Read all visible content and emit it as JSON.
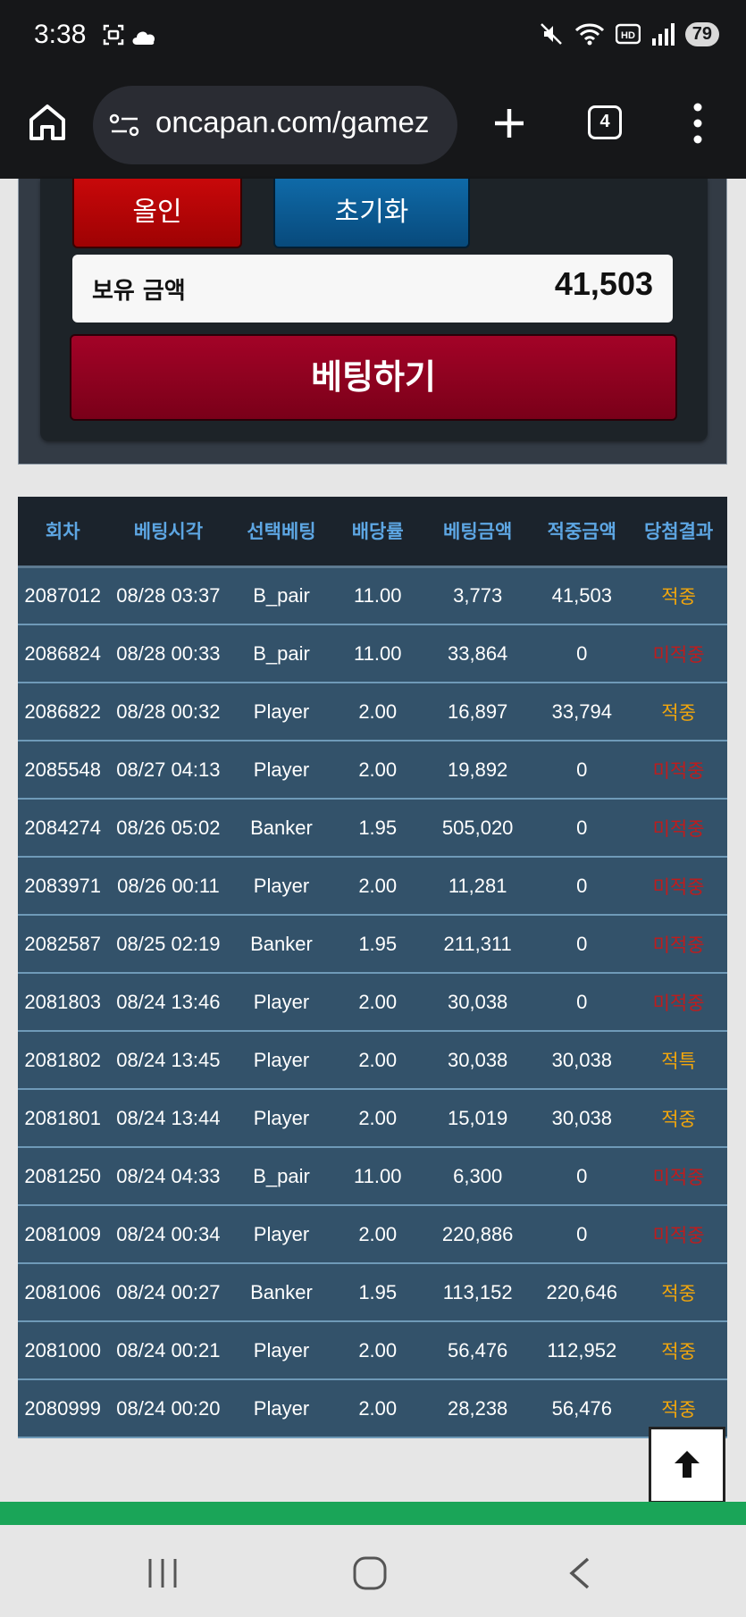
{
  "status_bar": {
    "time": "3:38",
    "battery": "79",
    "icons": [
      "screenshot-icon",
      "cloud-icon",
      "mute-icon",
      "wifi-icon",
      "hd-icon",
      "signal-icon"
    ]
  },
  "browser": {
    "url": "oncapan.com/gamez",
    "tab_count": "4"
  },
  "bet_panel": {
    "allin_label": "올인",
    "reset_label": "초기화",
    "balance_label": "보유 금액",
    "balance_value": "41,503",
    "bet_label": "베팅하기"
  },
  "table": {
    "headers": [
      "회차",
      "베팅시각",
      "선택베팅",
      "배당률",
      "베팅금액",
      "적중금액",
      "당첨결과"
    ],
    "rows": [
      {
        "round": "2087012",
        "time": "08/28 03:37",
        "pick": "B_pair",
        "odds": "11.00",
        "bet": "3,773",
        "payout": "41,503",
        "result": "적중",
        "status": "win"
      },
      {
        "round": "2086824",
        "time": "08/28 00:33",
        "pick": "B_pair",
        "odds": "11.00",
        "bet": "33,864",
        "payout": "0",
        "result": "미적중",
        "status": "lose"
      },
      {
        "round": "2086822",
        "time": "08/28 00:32",
        "pick": "Player",
        "odds": "2.00",
        "bet": "16,897",
        "payout": "33,794",
        "result": "적중",
        "status": "win"
      },
      {
        "round": "2085548",
        "time": "08/27 04:13",
        "pick": "Player",
        "odds": "2.00",
        "bet": "19,892",
        "payout": "0",
        "result": "미적중",
        "status": "lose"
      },
      {
        "round": "2084274",
        "time": "08/26 05:02",
        "pick": "Banker",
        "odds": "1.95",
        "bet": "505,020",
        "payout": "0",
        "result": "미적중",
        "status": "lose"
      },
      {
        "round": "2083971",
        "time": "08/26 00:11",
        "pick": "Player",
        "odds": "2.00",
        "bet": "11,281",
        "payout": "0",
        "result": "미적중",
        "status": "lose"
      },
      {
        "round": "2082587",
        "time": "08/25 02:19",
        "pick": "Banker",
        "odds": "1.95",
        "bet": "211,311",
        "payout": "0",
        "result": "미적중",
        "status": "lose"
      },
      {
        "round": "2081803",
        "time": "08/24 13:46",
        "pick": "Player",
        "odds": "2.00",
        "bet": "30,038",
        "payout": "0",
        "result": "미적중",
        "status": "lose"
      },
      {
        "round": "2081802",
        "time": "08/24 13:45",
        "pick": "Player",
        "odds": "2.00",
        "bet": "30,038",
        "payout": "30,038",
        "result": "적특",
        "status": "win"
      },
      {
        "round": "2081801",
        "time": "08/24 13:44",
        "pick": "Player",
        "odds": "2.00",
        "bet": "15,019",
        "payout": "30,038",
        "result": "적중",
        "status": "win"
      },
      {
        "round": "2081250",
        "time": "08/24 04:33",
        "pick": "B_pair",
        "odds": "11.00",
        "bet": "6,300",
        "payout": "0",
        "result": "미적중",
        "status": "lose"
      },
      {
        "round": "2081009",
        "time": "08/24 00:34",
        "pick": "Player",
        "odds": "2.00",
        "bet": "220,886",
        "payout": "0",
        "result": "미적중",
        "status": "lose"
      },
      {
        "round": "2081006",
        "time": "08/24 00:27",
        "pick": "Banker",
        "odds": "1.95",
        "bet": "113,152",
        "payout": "220,646",
        "result": "적중",
        "status": "win"
      },
      {
        "round": "2081000",
        "time": "08/24 00:21",
        "pick": "Player",
        "odds": "2.00",
        "bet": "56,476",
        "payout": "112,952",
        "result": "적중",
        "status": "win"
      },
      {
        "round": "2080999",
        "time": "08/24 00:20",
        "pick": "Player",
        "odds": "2.00",
        "bet": "28,238",
        "payout": "56,476",
        "result": "적중",
        "status": "win"
      }
    ]
  },
  "colors": {
    "win": "#f2a60c",
    "lose": "#c01c1c",
    "header_text": "#5da6e3",
    "row_bg": "#33526a"
  }
}
